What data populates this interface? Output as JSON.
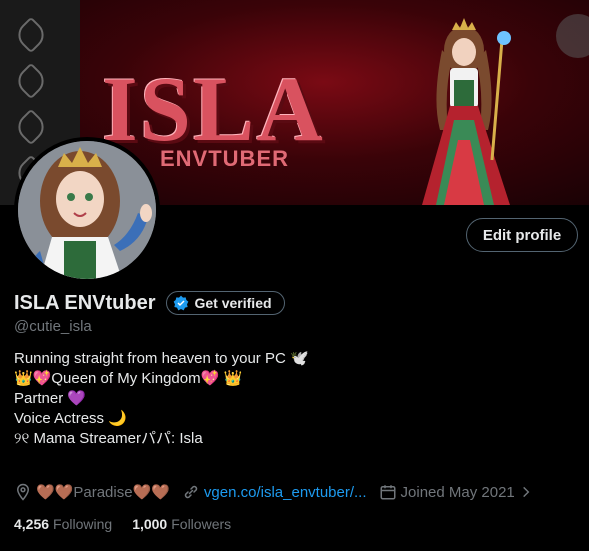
{
  "banner": {
    "title": "ISLA",
    "subtitle": "ENVTUBER"
  },
  "profile": {
    "edit_label": "Edit profile",
    "display_name": "ISLA ENVtuber",
    "verify_label": "Get verified",
    "handle": "@cutie_isla",
    "bio_lines": [
      "Running straight from heaven to your PC 🕊️",
      "👑💖Queen of My Kingdom💖 👑",
      "",
      "Partner 💜",
      "Voice Actress 🌙",
      "୨୧ Mama Streamerパパ: Isla"
    ],
    "location": "🤎🤎Paradise🤎🤎",
    "website": "vgen.co/isla_envtuber/...",
    "joined": "Joined May 2021",
    "following_count": "4,256",
    "following_label": "Following",
    "followers_count": "1,000",
    "followers_label": "Followers"
  },
  "colors": {
    "accent": "#1d9bf0",
    "banner_red": "#7a0a14",
    "text": "#e7e9ea",
    "muted": "#71767b"
  },
  "icons": [
    "location-icon",
    "link-icon",
    "calendar-icon",
    "verified-badge-icon",
    "chevron-right-icon"
  ]
}
